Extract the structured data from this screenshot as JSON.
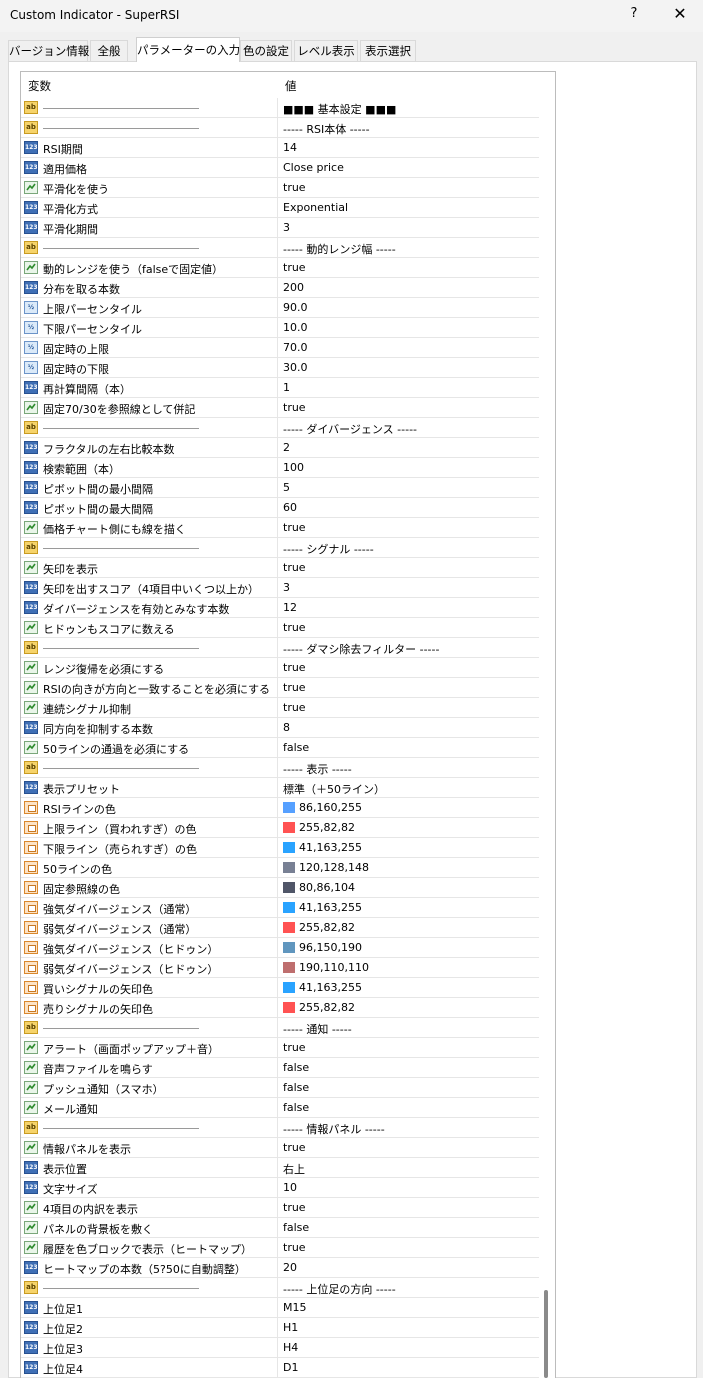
{
  "window": {
    "title": "Custom Indicator - SuperRSI",
    "help": "?",
    "close": "✕"
  },
  "tabs": [
    {
      "label": "バージョン情報"
    },
    {
      "label": "全般"
    },
    {
      "label": "パラメーターの入力"
    },
    {
      "label": "色の設定"
    },
    {
      "label": "レベル表示"
    },
    {
      "label": "表示選択"
    }
  ],
  "active_tab": "パラメーターの入力",
  "grid": {
    "col_name": "変数",
    "col_value": "値",
    "rows": [
      {
        "type": "ab",
        "name": "",
        "value": "■■■ 基本設定 ■■■"
      },
      {
        "type": "ab",
        "name": "",
        "value": "----- RSI本体 -----"
      },
      {
        "type": "123",
        "name": "RSI期間",
        "value": "14"
      },
      {
        "type": "123",
        "name": "適用価格",
        "value": "Close price"
      },
      {
        "type": "bool",
        "name": "平滑化を使う",
        "value": "true"
      },
      {
        "type": "123",
        "name": "平滑化方式",
        "value": "Exponential"
      },
      {
        "type": "123",
        "name": "平滑化期間",
        "value": "3"
      },
      {
        "type": "ab",
        "name": "",
        "value": "----- 動的レンジ幅 -----"
      },
      {
        "type": "bool",
        "name": "動的レンジを使う（falseで固定値）",
        "value": "true"
      },
      {
        "type": "123",
        "name": "分布を取る本数",
        "value": "200"
      },
      {
        "type": "dbl",
        "name": "上限パーセンタイル",
        "value": "90.0"
      },
      {
        "type": "dbl",
        "name": "下限パーセンタイル",
        "value": "10.0"
      },
      {
        "type": "dbl",
        "name": "固定時の上限",
        "value": "70.0"
      },
      {
        "type": "dbl",
        "name": "固定時の下限",
        "value": "30.0"
      },
      {
        "type": "123",
        "name": "再計算間隔（本）",
        "value": "1"
      },
      {
        "type": "bool",
        "name": "固定70/30を参照線として併記",
        "value": "true"
      },
      {
        "type": "ab",
        "name": "",
        "value": "----- ダイバージェンス -----"
      },
      {
        "type": "123",
        "name": "フラクタルの左右比較本数",
        "value": "2"
      },
      {
        "type": "123",
        "name": "検索範囲（本）",
        "value": "100"
      },
      {
        "type": "123",
        "name": "ピボット間の最小間隔",
        "value": "5"
      },
      {
        "type": "123",
        "name": "ピボット間の最大間隔",
        "value": "60"
      },
      {
        "type": "bool",
        "name": "価格チャート側にも線を描く",
        "value": "true"
      },
      {
        "type": "ab",
        "name": "",
        "value": "----- シグナル -----"
      },
      {
        "type": "bool",
        "name": "矢印を表示",
        "value": "true"
      },
      {
        "type": "123",
        "name": "矢印を出すスコア（4項目中いくつ以上か）",
        "value": "3"
      },
      {
        "type": "123",
        "name": "ダイバージェンスを有効とみなす本数",
        "value": "12"
      },
      {
        "type": "bool",
        "name": "ヒドゥンもスコアに数える",
        "value": "true"
      },
      {
        "type": "ab",
        "name": "",
        "value": "----- ダマシ除去フィルター -----"
      },
      {
        "type": "bool",
        "name": "レンジ復帰を必須にする",
        "value": "true"
      },
      {
        "type": "bool",
        "name": "RSIの向きが方向と一致することを必須にする",
        "value": "true"
      },
      {
        "type": "bool",
        "name": "連続シグナル抑制",
        "value": "true"
      },
      {
        "type": "123",
        "name": "同方向を抑制する本数",
        "value": "8"
      },
      {
        "type": "bool",
        "name": "50ラインの通過を必須にする",
        "value": "false"
      },
      {
        "type": "ab",
        "name": "",
        "value": "----- 表示 -----"
      },
      {
        "type": "123",
        "name": "表示プリセット",
        "value": "標準（＋50ライン）"
      },
      {
        "type": "clr",
        "name": "RSIラインの色",
        "value": "86,160,255",
        "color": "#56a0ff"
      },
      {
        "type": "clr",
        "name": "上限ライン（買われすぎ）の色",
        "value": "255,82,82",
        "color": "#ff5252"
      },
      {
        "type": "clr",
        "name": "下限ライン（売られすぎ）の色",
        "value": "41,163,255",
        "color": "#29a3ff"
      },
      {
        "type": "clr",
        "name": "50ラインの色",
        "value": "120,128,148",
        "color": "#788094"
      },
      {
        "type": "clr",
        "name": "固定参照線の色",
        "value": "80,86,104",
        "color": "#505668"
      },
      {
        "type": "clr",
        "name": "強気ダイバージェンス（通常）",
        "value": "41,163,255",
        "color": "#29a3ff"
      },
      {
        "type": "clr",
        "name": "弱気ダイバージェンス（通常）",
        "value": "255,82,82",
        "color": "#ff5252"
      },
      {
        "type": "clr",
        "name": "強気ダイバージェンス（ヒドゥン）",
        "value": "96,150,190",
        "color": "#6096be"
      },
      {
        "type": "clr",
        "name": "弱気ダイバージェンス（ヒドゥン）",
        "value": "190,110,110",
        "color": "#be6e6e"
      },
      {
        "type": "clr",
        "name": "買いシグナルの矢印色",
        "value": "41,163,255",
        "color": "#29a3ff"
      },
      {
        "type": "clr",
        "name": "売りシグナルの矢印色",
        "value": "255,82,82",
        "color": "#ff5252"
      },
      {
        "type": "ab",
        "name": "",
        "value": "----- 通知 -----"
      },
      {
        "type": "bool",
        "name": "アラート（画面ポップアップ＋音）",
        "value": "true"
      },
      {
        "type": "bool",
        "name": "音声ファイルを鳴らす",
        "value": "false"
      },
      {
        "type": "bool",
        "name": "プッシュ通知（スマホ）",
        "value": "false"
      },
      {
        "type": "bool",
        "name": "メール通知",
        "value": "false"
      },
      {
        "type": "ab",
        "name": "",
        "value": "----- 情報パネル -----"
      },
      {
        "type": "bool",
        "name": "情報パネルを表示",
        "value": "true"
      },
      {
        "type": "123",
        "name": "表示位置",
        "value": "右上"
      },
      {
        "type": "123",
        "name": "文字サイズ",
        "value": "10"
      },
      {
        "type": "bool",
        "name": "4項目の内訳を表示",
        "value": "true"
      },
      {
        "type": "bool",
        "name": "パネルの背景板を敷く",
        "value": "false"
      },
      {
        "type": "bool",
        "name": "履歴を色ブロックで表示（ヒートマップ）",
        "value": "true"
      },
      {
        "type": "123",
        "name": "ヒートマップの本数（5?50に自動調整）",
        "value": "20"
      },
      {
        "type": "ab",
        "name": "",
        "value": "----- 上位足の方向 -----"
      },
      {
        "type": "123",
        "name": "上位足1",
        "value": "M15"
      },
      {
        "type": "123",
        "name": "上位足2",
        "value": "H1"
      },
      {
        "type": "123",
        "name": "上位足3",
        "value": "H4"
      },
      {
        "type": "123",
        "name": "上位足4",
        "value": "D1"
      }
    ]
  }
}
